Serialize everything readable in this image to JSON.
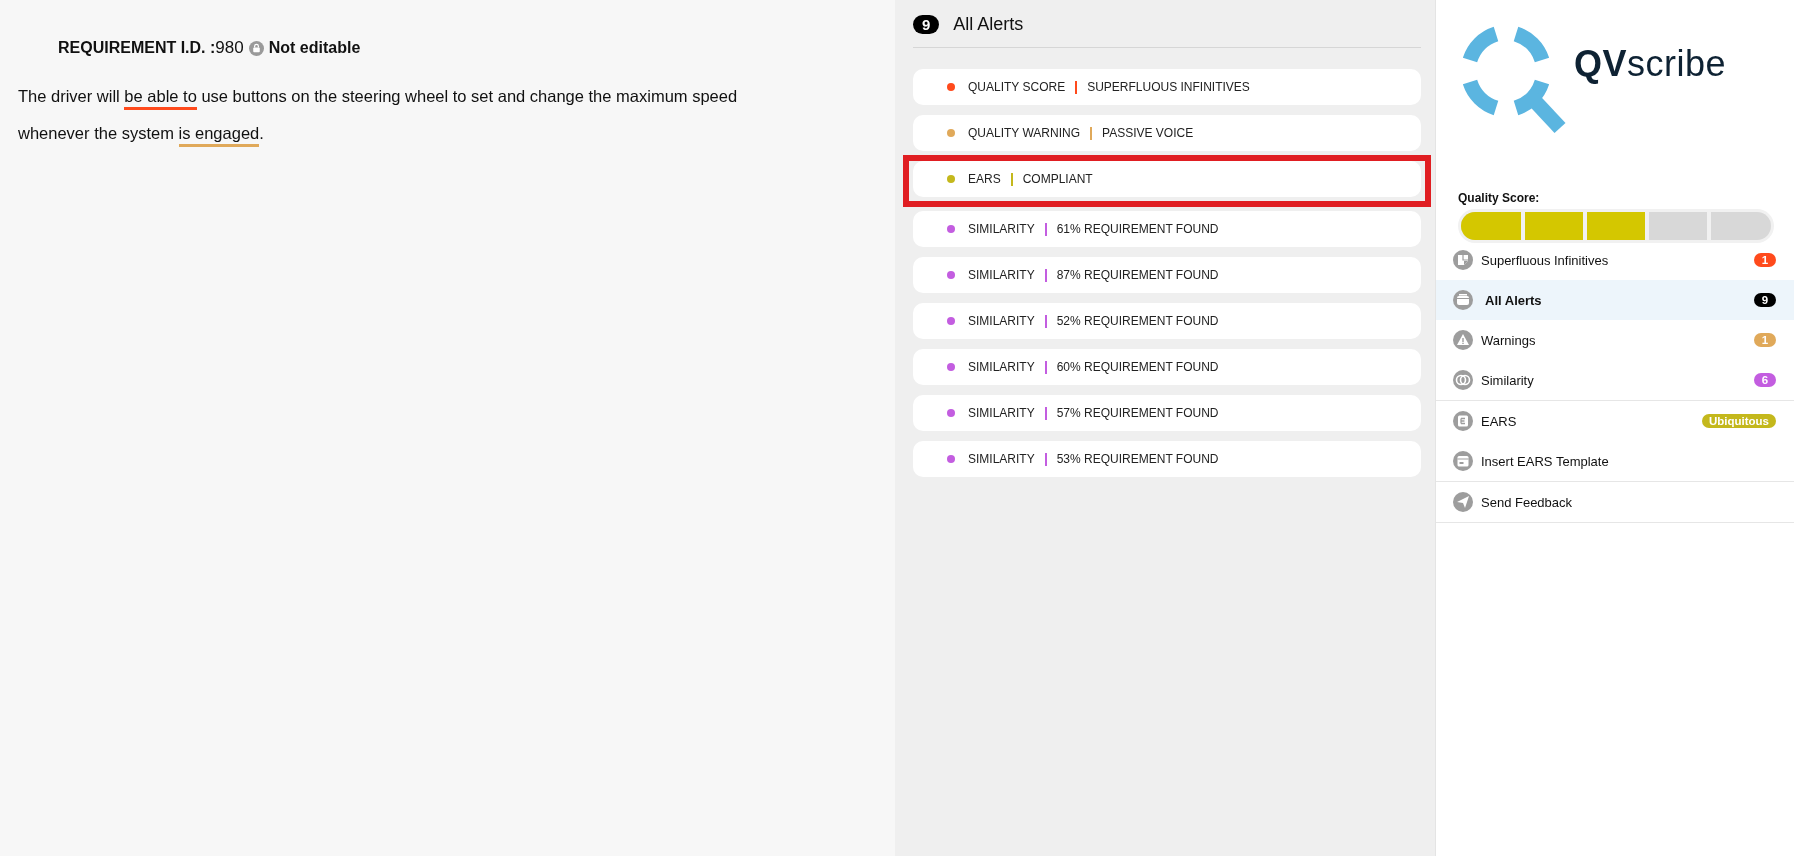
{
  "requirement": {
    "label": "REQUIREMENT I.D. :",
    "id": "980",
    "lock_text": "Not editable",
    "segments": [
      {
        "text": "The driver will "
      },
      {
        "text": "be able to",
        "color": "#ff4a1c"
      },
      {
        "text": " use buttons on the steering wheel to set and change the maximum speed whenever the system "
      },
      {
        "text": "is engaged",
        "color": "#e0a95a"
      },
      {
        "text": "."
      }
    ]
  },
  "alerts_panel": {
    "count": "9",
    "title": "All Alerts",
    "alerts": [
      {
        "category": "QUALITY SCORE",
        "detail": "SUPERFLUOUS INFINITIVES",
        "color": "#ff4a1c",
        "highlighted": false
      },
      {
        "category": "QUALITY WARNING",
        "detail": "PASSIVE VOICE",
        "color": "#e0a95a",
        "highlighted": false
      },
      {
        "category": "EARS",
        "detail": "COMPLIANT",
        "color": "#c4b81c",
        "highlighted": true
      },
      {
        "category": "SIMILARITY",
        "detail": "61% REQUIREMENT FOUND",
        "color": "#c35de0",
        "highlighted": false
      },
      {
        "category": "SIMILARITY",
        "detail": "87% REQUIREMENT FOUND",
        "color": "#c35de0",
        "highlighted": false
      },
      {
        "category": "SIMILARITY",
        "detail": "52% REQUIREMENT FOUND",
        "color": "#c35de0",
        "highlighted": false
      },
      {
        "category": "SIMILARITY",
        "detail": "60% REQUIREMENT FOUND",
        "color": "#c35de0",
        "highlighted": false
      },
      {
        "category": "SIMILARITY",
        "detail": "57% REQUIREMENT FOUND",
        "color": "#c35de0",
        "highlighted": false
      },
      {
        "category": "SIMILARITY",
        "detail": "53% REQUIREMENT FOUND",
        "color": "#c35de0",
        "highlighted": false
      }
    ]
  },
  "sidebar": {
    "logo": {
      "bold": "QV",
      "light": "scribe"
    },
    "quality_score": {
      "label": "Quality Score:",
      "level": 0.6
    },
    "groups": [
      [
        {
          "label": "Superfluous Infinitives",
          "kind": "note",
          "badge": "1",
          "color": "#ff4a1c",
          "selected": false
        },
        {
          "label": "All Alerts",
          "kind": "tray",
          "badge": "9",
          "color": "#000000",
          "selected": true
        },
        {
          "label": "Warnings",
          "kind": "warning",
          "badge": "1",
          "color": "#e0a95a",
          "selected": false
        },
        {
          "label": "Similarity",
          "kind": "rings",
          "badge": "6",
          "color": "#c35de0",
          "selected": false
        }
      ],
      [
        {
          "label": "EARS",
          "kind": "letter",
          "badge": "Ubiquitous",
          "color": "#c4b81c",
          "selected": false
        },
        {
          "label": "Insert EARS Template",
          "kind": "calendar",
          "selected": false
        }
      ],
      [
        {
          "label": "Send Feedback",
          "kind": "plane",
          "selected": false
        }
      ]
    ]
  }
}
